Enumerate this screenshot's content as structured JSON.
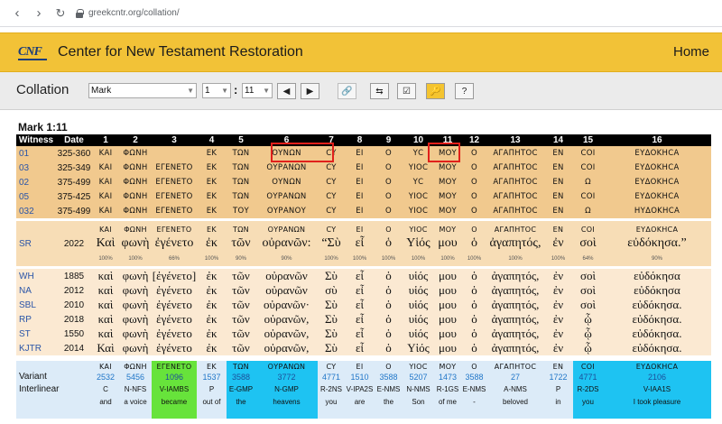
{
  "browser": {
    "url": "greekcntr.org/collation/"
  },
  "site": {
    "logo_text": "CNF",
    "title": "Center for New Testament Restoration",
    "home_label": "Home"
  },
  "toolbar": {
    "label": "Collation",
    "book": "Mark",
    "chapter": "1",
    "verse": "11",
    "icons": [
      "prev-icon",
      "next-icon",
      "link-icon",
      "swap-icon",
      "check-icon",
      "key-icon",
      "help-icon"
    ]
  },
  "verse_title": "Mark 1:11",
  "header": {
    "witness": "Witness",
    "date": "Date",
    "cols": [
      "1",
      "2",
      "3",
      "4",
      "5",
      "6",
      "7",
      "8",
      "9",
      "10",
      "11",
      "12",
      "13",
      "14",
      "15",
      "16"
    ]
  },
  "manuscripts": [
    {
      "witness": "01",
      "date": "325-360",
      "words": [
        "ΚΑΙ",
        "ΦΩΝΗ",
        "",
        "ΕΚ",
        "ΤΩΝ",
        "ΟΥΝΩΝ",
        "CY",
        "ΕΙ",
        "Ο",
        "ΥC",
        "ΜΟΥ",
        "Ο",
        "ΑΓΑΠΗΤΟC",
        "ΕΝ",
        "COI",
        "ΕΥΔΟΚΗCΑ"
      ]
    },
    {
      "witness": "03",
      "date": "325-349",
      "words": [
        "ΚΑΙ",
        "ΦΩΝΗ",
        "ΕΓΕΝΕΤΟ",
        "ΕΚ",
        "ΤΩΝ",
        "ΟΥΡΑΝΩΝ",
        "CY",
        "ΕΙ",
        "Ο",
        "ΥΙΟC",
        "ΜΟΥ",
        "Ο",
        "ΑΓΑΠΗΤΟC",
        "ΕΝ",
        "COI",
        "ΕΥΔΟΚΗCΑ"
      ]
    },
    {
      "witness": "02",
      "date": "375-499",
      "words": [
        "ΚΑΙ",
        "ΦΩΝΗ",
        "ΕΓΕΝΕΤΟ",
        "ΕΚ",
        "ΤΩΝ",
        "ΟΥΝΩΝ",
        "CY",
        "ΕΙ",
        "Ο",
        "ΥC",
        "ΜΟΥ",
        "Ο",
        "ΑΓΑΠΗΤΟC",
        "ΕΝ",
        "Ω",
        "ΕΥΔΟΚΗCΑ"
      ]
    },
    {
      "witness": "05",
      "date": "375-425",
      "words": [
        "ΚΑΙ",
        "ΦΩΝΗ",
        "ΕΓΕΝΕΤΟ",
        "ΕΚ",
        "ΤΩΝ",
        "ΟΥΡΑΝΩΝ",
        "CY",
        "ΕΙ",
        "Ο",
        "ΥΙΟC",
        "ΜΟΥ",
        "Ο",
        "ΑΓΑΠΗΤΟC",
        "ΕΝ",
        "COI",
        "ΕΥΔΟΚΗCΑ"
      ]
    },
    {
      "witness": "032",
      "date": "375-499",
      "words": [
        "ΚΑΙ",
        "ΦΩΝΗ",
        "ΕΓΕΝΕΤΟ",
        "ΕΚ",
        "ΤΟΥ",
        "ΟΥΡΑΝΟΥ",
        "CY",
        "ΕΙ",
        "Ο",
        "ΥΙΟC",
        "ΜΟΥ",
        "Ο",
        "ΑΓΑΠΗΤΟC",
        "ΕΝ",
        "Ω",
        "ΗΥΔΟΚΗCΑ"
      ]
    }
  ],
  "sr": {
    "witness": "SR",
    "date": "2022",
    "uncial": [
      "ΚΑΙ",
      "ΦΩΝΗ",
      "ΕΓΕΝΕΤΟ",
      "ΕΚ",
      "ΤΩΝ",
      "ΟΥΡΑΝΩΝ",
      "CY",
      "ΕΙ",
      "Ο",
      "ΥΙΟC",
      "ΜΟΥ",
      "Ο",
      "ΑΓΑΠΗΤΟC",
      "ΕΝ",
      "COI",
      "ΕΥΔΟΚΗCΑ"
    ],
    "text": [
      "Καὶ",
      "φωνὴ",
      "ἐγένετο",
      "ἐκ",
      "τῶν",
      "οὐρανῶν:",
      "“Σὺ",
      "εἶ",
      "ὁ",
      "Υἱός",
      "μου",
      "ὁ",
      "ἀγαπητός,",
      "ἐν",
      "σοὶ",
      "εὐδόκησα.”"
    ],
    "pct": [
      "100%",
      "100%",
      "66%",
      "100%",
      "90%",
      "90%",
      "100%",
      "100%",
      "100%",
      "100%",
      "100%",
      "100%",
      "100%",
      "100%",
      "64%",
      "90%"
    ]
  },
  "editions": [
    {
      "witness": "WH",
      "date": "1885",
      "words": [
        "καὶ",
        "φωνὴ",
        "[ἐγένετο]",
        "ἐκ",
        "τῶν",
        "οὐρανῶν",
        "Σὺ",
        "εἶ",
        "ὁ",
        "υἱός",
        "μου",
        "ὁ",
        "ἀγαπητός,",
        "ἐν",
        "σοὶ",
        "εὐδόκησα"
      ]
    },
    {
      "witness": "NA",
      "date": "2012",
      "words": [
        "καὶ",
        "φωνὴ",
        "ἐγένετο",
        "ἐκ",
        "τῶν",
        "οὐρανῶν",
        "σὺ",
        "εἶ",
        "ὁ",
        "υἱός",
        "μου",
        "ὁ",
        "ἀγαπητός,",
        "ἐν",
        "σοὶ",
        "εὐδόκησα"
      ]
    },
    {
      "witness": "SBL",
      "date": "2010",
      "words": [
        "καὶ",
        "φωνὴ",
        "ἐγένετο",
        "ἐκ",
        "τῶν",
        "οὐρανῶν·",
        "Σὺ",
        "εἶ",
        "ὁ",
        "υἱός",
        "μου",
        "ὁ",
        "ἀγαπητός,",
        "ἐν",
        "σοὶ",
        "εὐδόκησα."
      ]
    },
    {
      "witness": "RP",
      "date": "2018",
      "words": [
        "καὶ",
        "φωνὴ",
        "ἐγένετο",
        "ἐκ",
        "τῶν",
        "οὐρανῶν,",
        "Σὺ",
        "εἶ",
        "ὁ",
        "υἱός",
        "μου",
        "ὁ",
        "ἀγαπητός,",
        "ἐν",
        "ᾧ",
        "εὐδόκησα."
      ]
    },
    {
      "witness": "ST",
      "date": "1550",
      "words": [
        "καὶ",
        "φωνὴ",
        "ἐγένετο",
        "ἐκ",
        "τῶν",
        "οὐρανῶν,",
        "Σὺ",
        "εἶ",
        "ὁ",
        "υἱός",
        "μου",
        "ὁ",
        "ἀγαπητός,",
        "ἐν",
        "ᾧ",
        "εὐδόκησα."
      ]
    },
    {
      "witness": "KJTR",
      "date": "2014",
      "words": [
        "Καὶ",
        "φωνὴ",
        "ἐγένετο",
        "ἐκ",
        "τῶν",
        "οὐρανῶν,",
        "Σὺ",
        "εἶ",
        "ὁ",
        "Υἱός",
        "μου",
        "ὁ",
        "ἀγαπητός,",
        "ἐν",
        "ᾧ",
        "εὐδόκησα."
      ]
    }
  ],
  "variant": {
    "label": "Variant",
    "uncial": [
      "ΚΑΙ",
      "ΦΩΝΗ",
      "ΕΓΕΝΕΤΟ",
      "ΕΚ",
      "ΤΩΝ",
      "ΟΥΡΑΝΩΝ",
      "CY",
      "ΕΙ",
      "Ο",
      "ΥΙΟC",
      "ΜΟΥ",
      "Ο",
      "ΑΓΑΠΗΤΟC",
      "ΕΝ",
      "COI",
      "ΕΥΔΟΚΗCΑ"
    ],
    "numbers": [
      "2532",
      "5456",
      "1096",
      "1537",
      "3588",
      "3772",
      "4771",
      "1510",
      "3588",
      "5207",
      "1473",
      "3588",
      "27",
      "1722",
      "4771",
      "2106"
    ]
  },
  "interlinear": {
    "label": "Interlinear",
    "parsing": [
      "C",
      "N-NFS",
      "V-IAMBS",
      "P",
      "E-GMP",
      "N-GMP",
      "R-2NS",
      "V-IPA2S",
      "E-NMS",
      "N-NMS",
      "R-1GS",
      "E-NMS",
      "A-NMS",
      "P",
      "R-2DS",
      "V-IAA1S"
    ],
    "gloss": [
      "and",
      "a voice",
      "became",
      "out of",
      "the",
      "heavens",
      "you",
      "are",
      "the",
      "Son",
      "of me",
      "-",
      "beloved",
      "in",
      "you",
      "I took pleasure"
    ]
  },
  "colors": {
    "header_yellow": "#f2c237",
    "manuscript_row": "#f1c98e",
    "sr_row": "#f7ddb6",
    "edition_row": "#fbe9d2",
    "variant_row": "#dcebf8",
    "highlight_green": "#67e33b",
    "highlight_cyan": "#1ec3f2",
    "annotation_red": "#e0201b",
    "witness_link": "#2a55a8"
  }
}
